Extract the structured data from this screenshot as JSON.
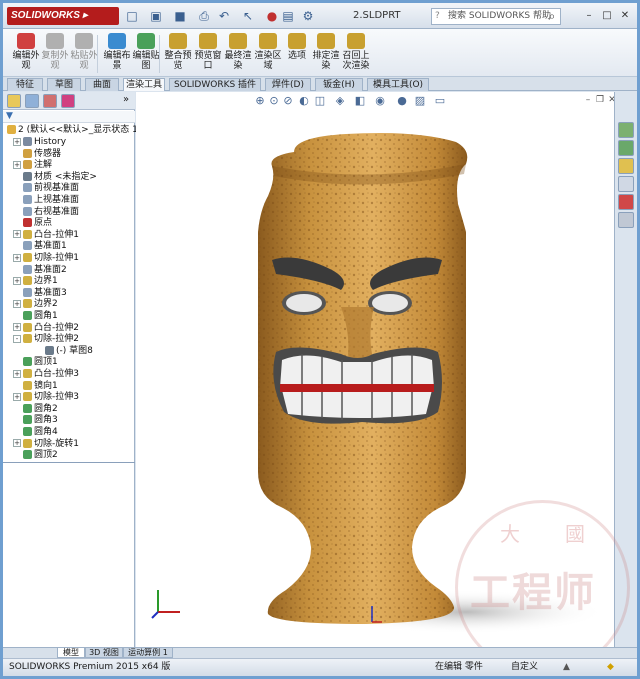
{
  "app": {
    "logo": "SOLIDWORKS",
    "doc_title": "2.SLDPRT"
  },
  "search": {
    "placeholder": "搜索 SOLIDWORKS 帮助"
  },
  "ribbon": {
    "buttons": [
      {
        "label": "编辑外观",
        "icon": "appearance-icon",
        "color": "#d04040",
        "disabled": false
      },
      {
        "label": "复制外观",
        "icon": "copy-appearance-icon",
        "color": "#b0b0b0",
        "disabled": true
      },
      {
        "label": "粘贴外观",
        "icon": "paste-appearance-icon",
        "color": "#b0b0b0",
        "disabled": true
      },
      {
        "label": "编辑布景",
        "icon": "scene-icon",
        "color": "#3a8bd0",
        "disabled": false
      },
      {
        "label": "编辑贴图",
        "icon": "decal-icon",
        "color": "#4aa05a",
        "disabled": false
      },
      {
        "label": "整合预览",
        "icon": "integrated-preview-icon",
        "color": "#c8a030",
        "disabled": false
      },
      {
        "label": "预览窗口",
        "icon": "preview-window-icon",
        "color": "#c8a030",
        "disabled": false
      },
      {
        "label": "最终渲染",
        "icon": "final-render-icon",
        "color": "#c8a030",
        "disabled": false
      },
      {
        "label": "渲染区域",
        "icon": "render-region-icon",
        "color": "#c8a030",
        "disabled": false
      },
      {
        "label": "选项",
        "icon": "options-icon",
        "color": "#c8a030",
        "disabled": false
      },
      {
        "label": "排定渲染",
        "icon": "schedule-render-icon",
        "color": "#c8a030",
        "disabled": false
      },
      {
        "label": "召回上次渲染",
        "icon": "recall-render-icon",
        "color": "#c8a030",
        "disabled": false
      }
    ]
  },
  "tabs": [
    {
      "label": "特征",
      "active": false
    },
    {
      "label": "草图",
      "active": false
    },
    {
      "label": "曲面",
      "active": false
    },
    {
      "label": "渲染工具",
      "active": true
    },
    {
      "label": "SOLIDWORKS 插件",
      "active": false
    },
    {
      "label": "焊件(D)",
      "active": false
    },
    {
      "label": "钣金(H)",
      "active": false
    },
    {
      "label": "模具工具(O)",
      "active": false
    }
  ],
  "tree": {
    "root": "2  (默认<<默认>_显示状态 1>)",
    "items": [
      {
        "label": "History",
        "icon_color": "#7a8aa0",
        "expander": "+"
      },
      {
        "label": "传感器",
        "icon_color": "#d0a040",
        "expander": ""
      },
      {
        "label": "注解",
        "icon_color": "#d0a040",
        "expander": "+"
      },
      {
        "label": "材质 <未指定>",
        "icon_color": "#6a7a8a",
        "expander": ""
      },
      {
        "label": "前视基准面",
        "icon_color": "#8aa0bb",
        "expander": ""
      },
      {
        "label": "上视基准面",
        "icon_color": "#8aa0bb",
        "expander": ""
      },
      {
        "label": "右视基准面",
        "icon_color": "#8aa0bb",
        "expander": ""
      },
      {
        "label": "原点",
        "icon_color": "#c03030",
        "expander": ""
      },
      {
        "label": "凸台-拉伸1",
        "icon_color": "#d0b040",
        "expander": "+"
      },
      {
        "label": "基准面1",
        "icon_color": "#8aa0bb",
        "expander": ""
      },
      {
        "label": "切除-拉伸1",
        "icon_color": "#d0b040",
        "expander": "+"
      },
      {
        "label": "基准面2",
        "icon_color": "#8aa0bb",
        "expander": ""
      },
      {
        "label": "边界1",
        "icon_color": "#d0b040",
        "expander": "+"
      },
      {
        "label": "基准面3",
        "icon_color": "#8aa0bb",
        "expander": ""
      },
      {
        "label": "边界2",
        "icon_color": "#d0b040",
        "expander": "+"
      },
      {
        "label": "圆角1",
        "icon_color": "#4aa05a",
        "expander": ""
      },
      {
        "label": "凸台-拉伸2",
        "icon_color": "#d0b040",
        "expander": "+"
      },
      {
        "label": "切除-拉伸2",
        "icon_color": "#d0b040",
        "expander": "-"
      },
      {
        "label": "(-) 草图8",
        "icon_color": "#6a7a8a",
        "expander": "",
        "indent": true
      },
      {
        "label": "圆顶1",
        "icon_color": "#4aa05a",
        "expander": ""
      },
      {
        "label": "凸台-拉伸3",
        "icon_color": "#d0b040",
        "expander": "+"
      },
      {
        "label": "镜向1",
        "icon_color": "#d0b040",
        "expander": ""
      },
      {
        "label": "切除-拉伸3",
        "icon_color": "#d0b040",
        "expander": "+"
      },
      {
        "label": "圆角2",
        "icon_color": "#4aa05a",
        "expander": ""
      },
      {
        "label": "圆角3",
        "icon_color": "#4aa05a",
        "expander": ""
      },
      {
        "label": "圆角4",
        "icon_color": "#4aa05a",
        "expander": ""
      },
      {
        "label": "切除-旋转1",
        "icon_color": "#d0b040",
        "expander": "+"
      },
      {
        "label": "圆顶2",
        "icon_color": "#4aa05a",
        "expander": ""
      }
    ]
  },
  "bottom_tabs": [
    {
      "label": "模型",
      "active": true
    },
    {
      "label": "3D 视图",
      "active": false
    },
    {
      "label": "运动算例 1",
      "active": false
    }
  ],
  "status": {
    "product": "SOLIDWORKS Premium 2015 x64 版",
    "mode": "在编辑 零件",
    "units": "自定义"
  },
  "watermark": {
    "text": "工程师",
    "small_left": "大",
    "small_right": "國"
  }
}
